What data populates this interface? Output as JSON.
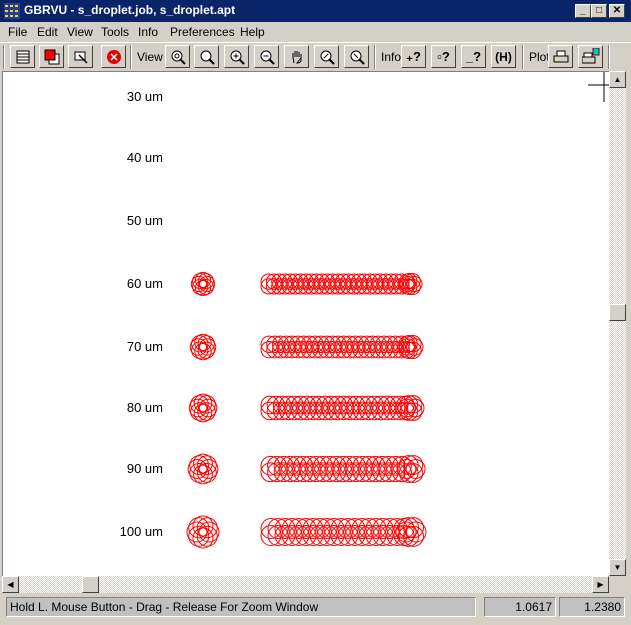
{
  "window": {
    "title": "GBRVU - s_droplet.job, s_droplet.apt",
    "controls": [
      "minimize",
      "maximize",
      "close"
    ]
  },
  "menu": [
    "File",
    "Edit",
    "View",
    "Tools",
    "Info",
    "Preferences",
    "Help"
  ],
  "toolbar": {
    "groups": [
      {
        "label": "",
        "buttons": [
          "layers-icon",
          "color-layer-icon",
          "select-edit-icon",
          "stop-icon"
        ]
      },
      {
        "label": "View",
        "buttons": [
          "zoom-fit-icon",
          "zoom-window-icon",
          "zoom-in-icon",
          "zoom-out-icon",
          "pan-hand-icon",
          "zoom-previous-icon",
          "zoom-next-icon"
        ]
      },
      {
        "label": "Info",
        "buttons": [
          "point-query-icon",
          "box-query-icon",
          "measure-query-icon",
          "distance-icon"
        ]
      },
      {
        "label": "Plot",
        "buttons": [
          "print-icon",
          "print-setup-icon"
        ]
      }
    ],
    "view_label": "View",
    "info_label": "Info",
    "plot_label": "Plot"
  },
  "canvas": {
    "rows": [
      {
        "label": "30 um",
        "has_drops": false
      },
      {
        "label": "40 um",
        "has_drops": false
      },
      {
        "label": "50 um",
        "has_drops": false
      },
      {
        "label": "60 um",
        "has_drops": true,
        "dot_scale": 0.6
      },
      {
        "label": "70 um",
        "has_drops": true,
        "dot_scale": 0.7
      },
      {
        "label": "80 um",
        "has_drops": true,
        "dot_scale": 0.8
      },
      {
        "label": "90 um",
        "has_drops": true,
        "dot_scale": 0.9
      },
      {
        "label": "100 um",
        "has_drops": true,
        "dot_scale": 1.0
      }
    ],
    "drop_color": "#ff0000"
  },
  "status": {
    "message": "Hold L. Mouse Button - Drag - Release For Zoom Window",
    "x": "1.0617",
    "y": "1.2380"
  }
}
